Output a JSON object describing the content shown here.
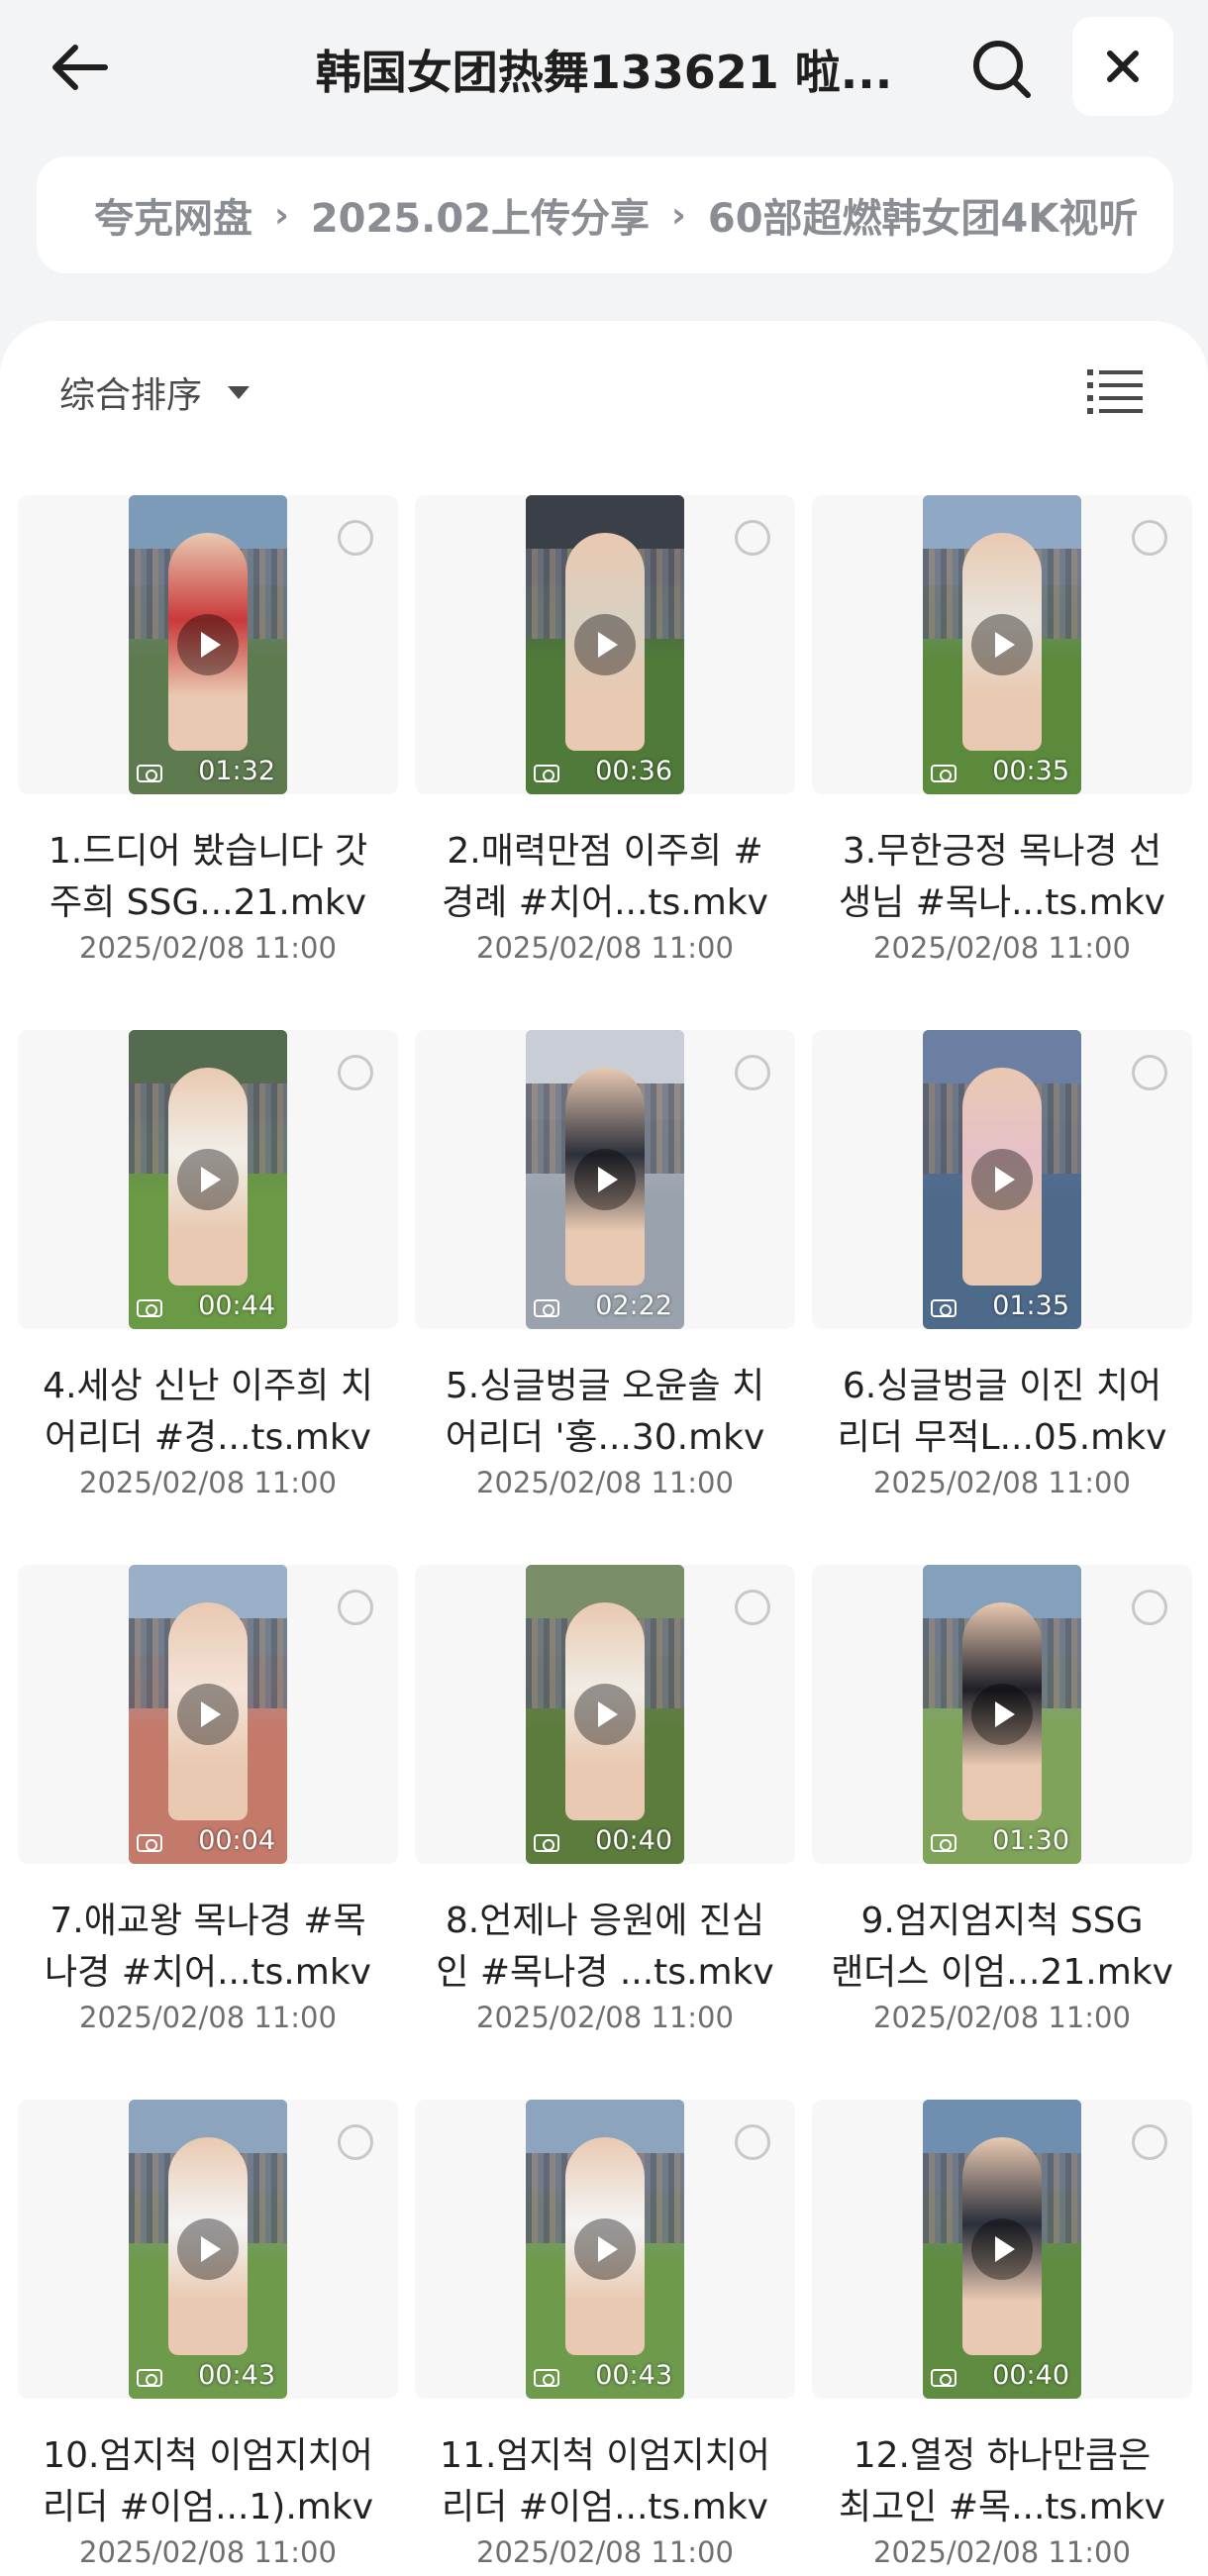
{
  "header": {
    "title": "韩国女团热舞133621 啦...",
    "back_icon": "arrow-left-icon",
    "search_icon": "search-icon",
    "close_icon": "close-icon"
  },
  "breadcrumb": [
    "夸克网盘",
    "2025.02上传分享",
    "60部超燃韩女团4K视听"
  ],
  "toolbar": {
    "sort_label": "综合排序",
    "view_icon": "list-view-icon"
  },
  "colors": {
    "accent": "#1f1f1f",
    "panel": "#ffffff",
    "background": "#f3f4f6"
  },
  "files": [
    {
      "line1": "1.드디어 봤습니다 갓",
      "line2": "주희 SSG...21.mkv",
      "date": "2025/02/08 11:00",
      "duration": "01:32"
    },
    {
      "line1": "2.매력만점 이주희 #",
      "line2": "경례 #치어...ts.mkv",
      "date": "2025/02/08 11:00",
      "duration": "00:36"
    },
    {
      "line1": "3.무한긍정 목나경 선",
      "line2": "생님 #목나...ts.mkv",
      "date": "2025/02/08 11:00",
      "duration": "00:35"
    },
    {
      "line1": "4.세상 신난 이주희 치",
      "line2": "어리더 #경...ts.mkv",
      "date": "2025/02/08 11:00",
      "duration": "00:44"
    },
    {
      "line1": "5.싱글벙글 오윤솔 치",
      "line2": "어리더 '홍...30.mkv",
      "date": "2025/02/08 11:00",
      "duration": "02:22"
    },
    {
      "line1": "6.싱글벙글 이진 치어",
      "line2": "리더 무적L...05.mkv",
      "date": "2025/02/08 11:00",
      "duration": "01:35"
    },
    {
      "line1": "7.애교왕 목나경 #목",
      "line2": "나경 #치어...ts.mkv",
      "date": "2025/02/08 11:00",
      "duration": "00:04"
    },
    {
      "line1": "8.언제나 응원에 진심",
      "line2": "인 #목나경 ...ts.mkv",
      "date": "2025/02/08 11:00",
      "duration": "00:40"
    },
    {
      "line1": "9.엄지엄지척 SSG",
      "line2": "랜더스 이엄...21.mkv",
      "date": "2025/02/08 11:00",
      "duration": "01:30"
    },
    {
      "line1": "10.엄지척 이엄지치어",
      "line2": "리더 #이엄...1).mkv",
      "date": "2025/02/08 11:00",
      "duration": "00:43"
    },
    {
      "line1": "11.엄지척 이엄지치어",
      "line2": "리더 #이엄...ts.mkv",
      "date": "2025/02/08 11:00",
      "duration": "00:43"
    },
    {
      "line1": "12.열정 하나만큼은",
      "line2": "최고인 #목...ts.mkv",
      "date": "2025/02/08 11:00",
      "duration": "00:40"
    }
  ]
}
